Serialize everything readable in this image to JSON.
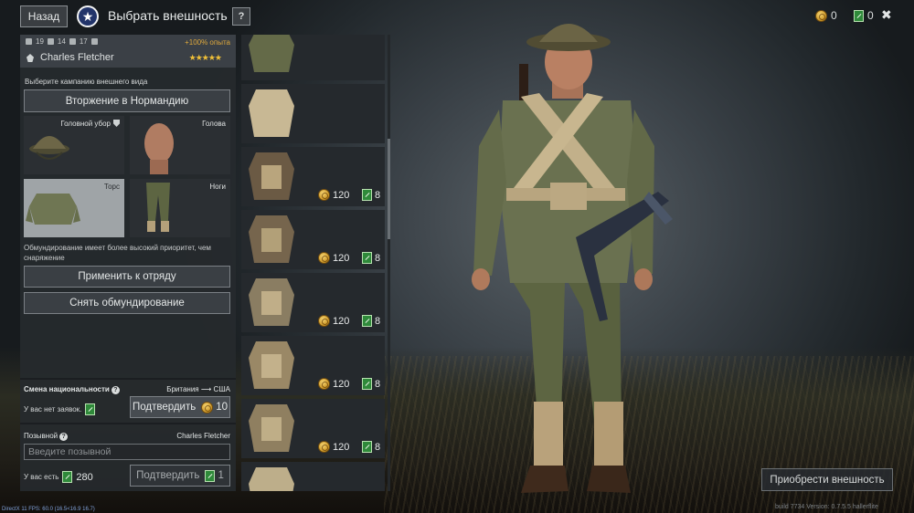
{
  "header": {
    "back_label": "Назад",
    "title": "Выбрать внешность",
    "help_label": "?",
    "gold": "0",
    "tickets": "0",
    "close_label": "✖"
  },
  "soldier": {
    "stat1": "19",
    "stat2": "14",
    "stat3": "17",
    "exp_bonus": "+100% опыта",
    "name": "Charles Fletcher",
    "stars": "★★★★★"
  },
  "appearance": {
    "campaign_prompt": "Выберите кампанию внешнего вида",
    "campaign_button": "Вторжение в Нормандию",
    "slots": {
      "headgear": "Головной убор",
      "head": "Голова",
      "torso": "Торс",
      "legs": "Ноги"
    },
    "priority_note": "Обмундирование имеет более высокий приоритет, чем снаряжение",
    "apply_button": "Применить к отряду",
    "remove_button": "Снять обмундирование"
  },
  "nationality": {
    "title": "Смена национальности",
    "route": "Британия ⟶ США",
    "status": "У вас нет заявок.",
    "confirm_label": "Подтвердить",
    "cost": "10"
  },
  "callsign": {
    "title": "Позывной",
    "current_name": "Charles Fletcher",
    "placeholder": "Введите позывной",
    "have_label": "У вас есть",
    "have_amount": "280",
    "confirm_label": "Подтвердить",
    "cost": "1"
  },
  "items": [
    {
      "price": "",
      "tickets": ""
    },
    {
      "price": "",
      "tickets": ""
    },
    {
      "price": "120",
      "tickets": "8"
    },
    {
      "price": "120",
      "tickets": "8"
    },
    {
      "price": "120",
      "tickets": "8"
    },
    {
      "price": "120",
      "tickets": "8"
    },
    {
      "price": "120",
      "tickets": "8"
    },
    {
      "price": "",
      "tickets": ""
    }
  ],
  "footer": {
    "buy_button": "Приобрести внешность",
    "fps_text": "DirectX 11 FPS: 60.0 (16.5<16.9 16.7)",
    "version_text": "build 7734 Version: 0.7.5.5 hallerflite"
  },
  "colors": {
    "accent_gold": "#e0a93c",
    "ticket_green": "#2f8a3a",
    "nation_blue": "#22346a"
  }
}
